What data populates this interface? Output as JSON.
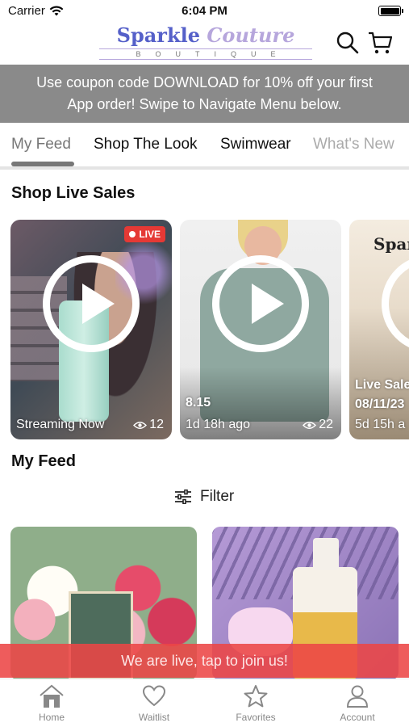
{
  "status_bar": {
    "carrier": "Carrier",
    "time": "6:04 PM",
    "battery_level": 1.0
  },
  "header": {
    "logo_word1": "Sparkle",
    "logo_word2": "Couture",
    "logo_sub": "BOUTIQUE",
    "icons": [
      "search-icon",
      "cart-icon"
    ]
  },
  "coupon_banner": {
    "line1": "Use coupon code DOWNLOAD for 10% off your first",
    "line2": "App order! Swipe to Navigate Menu below."
  },
  "tabs": [
    {
      "label": "My Feed",
      "active": true
    },
    {
      "label": "Shop The Look",
      "active": false
    },
    {
      "label": "Swimwear",
      "active": false
    },
    {
      "label": "What's New",
      "active": false
    }
  ],
  "live_sales": {
    "title": "Shop Live Sales",
    "cards": [
      {
        "badge": "LIVE",
        "status": "Streaming Now",
        "views": "12"
      },
      {
        "title": "8.15",
        "time": "1d 18h ago",
        "views": "22"
      },
      {
        "logo_text": "Spark",
        "title": "Live Sale",
        "date": "08/11/23",
        "time": "5d 15h a"
      }
    ]
  },
  "feed": {
    "title": "My Feed",
    "filter_label": "Filter"
  },
  "live_bar": {
    "text": "We are live, tap to join us!"
  },
  "bottom_nav": [
    {
      "label": "Home",
      "icon": "home-icon"
    },
    {
      "label": "Waitlist",
      "icon": "heart-icon"
    },
    {
      "label": "Favorites",
      "icon": "star-icon"
    },
    {
      "label": "Account",
      "icon": "account-icon"
    }
  ],
  "colors": {
    "banner_gray": "#8a8a8a",
    "live_red": "#e53935",
    "logo_blue": "#5560c9",
    "logo_lilac": "#b6a6dc"
  }
}
